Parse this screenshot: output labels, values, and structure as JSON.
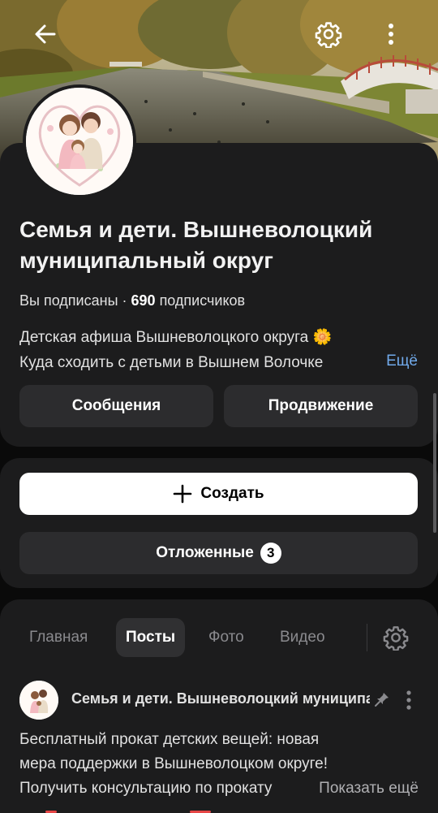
{
  "header": {
    "back_icon": "arrow-left-icon",
    "settings_icon": "gear-icon",
    "more_icon": "more-vertical-icon"
  },
  "profile": {
    "name": "Семья и дети. Вышневолоцкий муниципальный округ",
    "subscribed_label": "Вы подписаны",
    "separator": " · ",
    "subscribers_count": "690",
    "subscribers_label": "подписчиков",
    "description_line1": "Детская афиша Вышневолоцкого округа 🌼",
    "description_line2": "Куда сходить с детьми в Вышнем Волочке",
    "more_link": "Ещё",
    "messages_button": "Сообщения",
    "promotion_button": "Продвижение"
  },
  "actions": {
    "create_label": "Создать",
    "deferred_label": "Отложенные",
    "deferred_count": "3"
  },
  "tabs": [
    {
      "label": "Главная",
      "active": false
    },
    {
      "label": "Посты",
      "active": true
    },
    {
      "label": "Фото",
      "active": false
    },
    {
      "label": "Видео",
      "active": false
    }
  ],
  "post": {
    "author": "Семья и дети. Вышневолоцкий муниципальный округ",
    "line1": "Бесплатный прокат детских вещей: новая",
    "line2": "мера поддержки в Вышневолоцком округе!",
    "line3": "Получить консультацию по прокату",
    "show_more": "Показать ещё"
  },
  "colors": {
    "background": "#0a0a0a",
    "card": "#1c1c1d",
    "button": "#2c2c2e",
    "link": "#71aaeb",
    "accent_red": "#e64646"
  }
}
